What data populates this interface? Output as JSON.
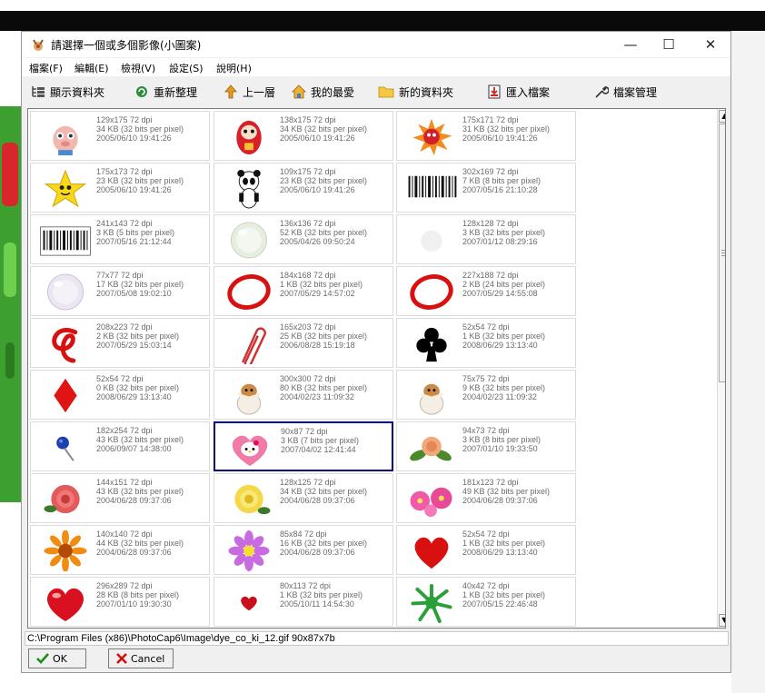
{
  "window": {
    "title": "請選擇一個或多個影像(小圖案)",
    "minimize_label": "—",
    "maximize_label": "☐",
    "close_label": "✕"
  },
  "menu": {
    "items": [
      "檔案(F)",
      "編輯(E)",
      "檢視(V)",
      "設定(S)",
      "說明(H)"
    ]
  },
  "toolbar": {
    "show_folder": "顯示資料夾",
    "refresh": "重新整理",
    "up_one_level": "上一層",
    "favorites": "我的最愛",
    "new_folder": "新的資料夾",
    "import_file": "匯入檔案",
    "file_management": "檔案管理"
  },
  "images": [
    {
      "dims": "129x175 72 dpi",
      "size": "34 KB (32 bits per pixel)",
      "date": "2005/06/10 19:41:26",
      "icon": "cartoon-pig-icon"
    },
    {
      "dims": "138x175 72 dpi",
      "size": "34 KB (32 bits per pixel)",
      "date": "2005/06/10 19:41:26",
      "icon": "daruma-doll-icon"
    },
    {
      "dims": "175x171 72 dpi",
      "size": "31 KB (32 bits per pixel)",
      "date": "2005/06/10 19:41:26",
      "icon": "cartoon-sun-icon"
    },
    {
      "dims": "175x173 72 dpi",
      "size": "23 KB (32 bits per pixel)",
      "date": "2005/06/10 19:41:26",
      "icon": "smiling-star-icon"
    },
    {
      "dims": "109x175 72 dpi",
      "size": "23 KB (32 bits per pixel)",
      "date": "2005/06/10 19:41:26",
      "icon": "panda-icon"
    },
    {
      "dims": "302x169 72 dpi",
      "size": "7 KB (8 bits per pixel)",
      "date": "2007/05/16 21:10:28",
      "icon": "barcode-icon"
    },
    {
      "dims": "241x143 72 dpi",
      "size": "3 KB (5 bits per pixel)",
      "date": "2007/05/16 21:12:44",
      "icon": "barcode-small-icon"
    },
    {
      "dims": "136x136 72 dpi",
      "size": "52 KB (32 bits per pixel)",
      "date": "2005/04/26 09:50:24",
      "icon": "glass-ball-icon"
    },
    {
      "dims": "128x128 72 dpi",
      "size": "3 KB (32 bits per pixel)",
      "date": "2007/01/12 08:29:16",
      "icon": "faint-circle-icon"
    },
    {
      "dims": "77x77 72 dpi",
      "size": "17 KB (32 bits per pixel)",
      "date": "2007/05/08 19:02:10",
      "icon": "bubble-icon"
    },
    {
      "dims": "184x168 72 dpi",
      "size": "1 KB (32 bits per pixel)",
      "date": "2007/05/29 14:57:02",
      "icon": "red-circle-icon"
    },
    {
      "dims": "227x188 72 dpi",
      "size": "2 KB (24 bits per pixel)",
      "date": "2007/05/29 14:55:08",
      "icon": "red-circle-icon"
    },
    {
      "dims": "208x223 72 dpi",
      "size": "2 KB (32 bits per pixel)",
      "date": "2007/05/29 15:03:14",
      "icon": "red-scribble-icon"
    },
    {
      "dims": "165x203 72 dpi",
      "size": "25 KB (32 bits per pixel)",
      "date": "2006/08/28 15:19:18",
      "icon": "paper-clip-icon"
    },
    {
      "dims": "52x54 72 dpi",
      "size": "1 KB (32 bits per pixel)",
      "date": "2008/06/29 13:13:40",
      "icon": "club-suit-icon"
    },
    {
      "dims": "52x54 72 dpi",
      "size": "0 KB (32 bits per pixel)",
      "date": "2008/06/29 13:13:40",
      "icon": "diamond-suit-icon"
    },
    {
      "dims": "300x300 72 dpi",
      "size": "80 KB (32 bits per pixel)",
      "date": "2004/02/23 11:09:32",
      "icon": "chick-egg-icon"
    },
    {
      "dims": "75x75 72 dpi",
      "size": "9 KB (32 bits per pixel)",
      "date": "2004/02/23 11:09:32",
      "icon": "chick-egg-icon"
    },
    {
      "dims": "182x254 72 dpi",
      "size": "43 KB (32 bits per pixel)",
      "date": "2006/09/07 14:38:00",
      "icon": "push-pin-icon"
    },
    {
      "dims": "90x87 72 dpi",
      "size": "3 KB (7 bits per pixel)",
      "date": "2007/04/02 12:41:44",
      "icon": "kitty-heart-icon",
      "selected": true
    },
    {
      "dims": "94x73 72 dpi",
      "size": "3 KB (8 bits per pixel)",
      "date": "2007/01/10 19:33:50",
      "icon": "rose-with-leaves-icon"
    },
    {
      "dims": "144x151 72 dpi",
      "size": "43 KB (32 bits per pixel)",
      "date": "2004/06/28 09:37:06",
      "icon": "red-rose-icon"
    },
    {
      "dims": "128x125 72 dpi",
      "size": "34 KB (32 bits per pixel)",
      "date": "2004/06/28 09:37:06",
      "icon": "yellow-rose-icon"
    },
    {
      "dims": "181x123 72 dpi",
      "size": "49 KB (32 bits per pixel)",
      "date": "2004/06/28 09:37:06",
      "icon": "pink-flowers-icon"
    },
    {
      "dims": "140x140 72 dpi",
      "size": "44 KB (32 bits per pixel)",
      "date": "2004/06/28 09:37:06",
      "icon": "gerbera-flower-icon"
    },
    {
      "dims": "85x84 72 dpi",
      "size": "16 KB (32 bits per pixel)",
      "date": "2004/06/28 09:37:06",
      "icon": "purple-flower-icon"
    },
    {
      "dims": "52x54 72 dpi",
      "size": "1 KB (32 bits per pixel)",
      "date": "2008/06/29 13:13:40",
      "icon": "heart-suit-icon"
    },
    {
      "dims": "296x289 72 dpi",
      "size": "28 KB (8 bits per pixel)",
      "date": "2007/01/10 19:30:30",
      "icon": "glossy-heart-icon"
    },
    {
      "dims": "80x113 72 dpi",
      "size": "1 KB (32 bits per pixel)",
      "date": "2005/10/11 14:54:30",
      "icon": "small-heart-icon"
    },
    {
      "dims": "40x42 72 dpi",
      "size": "1 KB (32 bits per pixel)",
      "date": "2007/05/15 22:46:48",
      "icon": "green-splat-icon"
    }
  ],
  "status": {
    "path": "C:\\Program Files (x86)\\PhotoCap6\\Image\\dye_co_ki_12.gif  90x87x7b"
  },
  "buttons": {
    "ok": "OK",
    "cancel": "Cancel"
  },
  "colors": {
    "selection_border": "#000080",
    "window_bg": "#f0f0f0",
    "info_text": "#6b6b6b"
  }
}
